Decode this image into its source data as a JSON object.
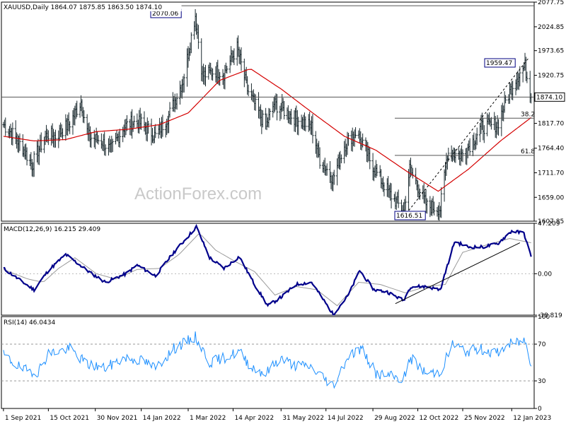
{
  "chart_data": [
    {
      "type": "candlestick",
      "panel": "price",
      "header": "XAUUSD,Daily  1864.07 1875.85 1863.50 1874.10",
      "watermark": "ActionForex.com",
      "ylim": [
        1607.85,
        2077.75
      ],
      "y_ticks": [
        "2077.75",
        "2024.85",
        "1973.65",
        "1920.75",
        "1869.60",
        "1817.70",
        "1764.40",
        "1711.70",
        "1659.00",
        "1607.85"
      ],
      "last_price_label": "1874.10",
      "colors": {
        "price": "#1b2a2f",
        "ma": "#d40000",
        "grid": "#9a9a9a",
        "annot": "#000080"
      },
      "annotations": {
        "high": {
          "label": "2070.06",
          "value": 2070.06,
          "date": "2022-03-08"
        },
        "swing_high": {
          "label": "1959.47",
          "value": 1959.47,
          "date": "2023-01-25"
        },
        "low": {
          "label": "1616.51",
          "value": 1616.51,
          "date": "2022-09-28"
        },
        "fib_38": {
          "label": "38.2",
          "value": 1828.7
        },
        "fib_61": {
          "label": "61.8",
          "value": 1749.1
        },
        "horizontal": [
          2070.06,
          1874.1,
          1828.7,
          1749.1
        ]
      },
      "price_anchors": [
        [
          "2021-09-01",
          1815
        ],
        [
          "2021-09-10",
          1795
        ],
        [
          "2021-09-20",
          1765
        ],
        [
          "2021-09-29",
          1728
        ],
        [
          "2021-10-05",
          1760
        ],
        [
          "2021-10-14",
          1795
        ],
        [
          "2021-10-22",
          1790
        ],
        [
          "2021-11-05",
          1818
        ],
        [
          "2021-11-16",
          1865
        ],
        [
          "2021-11-23",
          1790
        ],
        [
          "2021-12-06",
          1780
        ],
        [
          "2021-12-15",
          1760
        ],
        [
          "2021-12-28",
          1810
        ],
        [
          "2022-01-05",
          1820
        ],
        [
          "2022-01-14",
          1818
        ],
        [
          "2022-01-28",
          1790
        ],
        [
          "2022-02-10",
          1835
        ],
        [
          "2022-02-24",
          1910
        ],
        [
          "2022-03-08",
          2050
        ],
        [
          "2022-03-15",
          1920
        ],
        [
          "2022-03-28",
          1930
        ],
        [
          "2022-04-05",
          1925
        ],
        [
          "2022-04-18",
          1980
        ],
        [
          "2022-04-28",
          1890
        ],
        [
          "2022-05-16",
          1810
        ],
        [
          "2022-05-24",
          1860
        ],
        [
          "2022-06-13",
          1830
        ],
        [
          "2022-06-30",
          1810
        ],
        [
          "2022-07-08",
          1740
        ],
        [
          "2022-07-21",
          1700
        ],
        [
          "2022-08-01",
          1770
        ],
        [
          "2022-08-12",
          1800
        ],
        [
          "2022-08-26",
          1740
        ],
        [
          "2022-09-02",
          1710
        ],
        [
          "2022-09-15",
          1665
        ],
        [
          "2022-09-28",
          1630
        ],
        [
          "2022-10-04",
          1720
        ],
        [
          "2022-10-21",
          1640
        ],
        [
          "2022-11-03",
          1635
        ],
        [
          "2022-11-10",
          1755
        ],
        [
          "2022-11-24",
          1750
        ],
        [
          "2022-12-05",
          1780
        ],
        [
          "2022-12-13",
          1810
        ],
        [
          "2022-12-29",
          1815
        ],
        [
          "2023-01-06",
          1865
        ],
        [
          "2023-01-16",
          1915
        ],
        [
          "2023-01-25",
          1940
        ],
        [
          "2023-01-31",
          1874
        ]
      ],
      "ma_anchors": [
        [
          "2021-09-01",
          1790
        ],
        [
          "2021-10-01",
          1780
        ],
        [
          "2021-11-01",
          1783
        ],
        [
          "2021-12-01",
          1800
        ],
        [
          "2022-01-01",
          1805
        ],
        [
          "2022-02-01",
          1815
        ],
        [
          "2022-03-01",
          1840
        ],
        [
          "2022-04-01",
          1910
        ],
        [
          "2022-05-01",
          1935
        ],
        [
          "2022-06-01",
          1890
        ],
        [
          "2022-07-01",
          1840
        ],
        [
          "2022-08-01",
          1790
        ],
        [
          "2022-09-01",
          1760
        ],
        [
          "2022-10-01",
          1715
        ],
        [
          "2022-11-01",
          1672
        ],
        [
          "2022-12-01",
          1720
        ],
        [
          "2023-01-01",
          1780
        ],
        [
          "2023-01-31",
          1830
        ]
      ]
    },
    {
      "type": "line",
      "panel": "macd",
      "header": "MACD(12,26,9) 16.215 29.409",
      "ylim": [
        -38.819,
        47.209
      ],
      "y_ticks": [
        "47.209",
        "0.00",
        "-38.819"
      ],
      "colors": {
        "macd": "#00008b",
        "signal": "#9a9a9a"
      },
      "trendline": {
        "from": [
          "2022-09-20",
          -28
        ],
        "to": [
          "2023-01-20",
          29
        ]
      },
      "macd_anchors": [
        [
          "2021-09-01",
          5
        ],
        [
          "2021-09-20",
          -8
        ],
        [
          "2021-10-01",
          -15
        ],
        [
          "2021-10-15",
          3
        ],
        [
          "2021-11-01",
          18
        ],
        [
          "2021-11-25",
          1
        ],
        [
          "2021-12-10",
          -8
        ],
        [
          "2021-12-30",
          0
        ],
        [
          "2022-01-10",
          8
        ],
        [
          "2022-01-28",
          -2
        ],
        [
          "2022-02-15",
          20
        ],
        [
          "2022-03-01",
          35
        ],
        [
          "2022-03-09",
          44
        ],
        [
          "2022-03-22",
          15
        ],
        [
          "2022-04-05",
          5
        ],
        [
          "2022-04-20",
          16
        ],
        [
          "2022-05-05",
          -10
        ],
        [
          "2022-05-18",
          -30
        ],
        [
          "2022-05-31",
          -22
        ],
        [
          "2022-06-15",
          -10
        ],
        [
          "2022-06-30",
          -8
        ],
        [
          "2022-07-21",
          -38
        ],
        [
          "2022-08-05",
          -20
        ],
        [
          "2022-08-16",
          3
        ],
        [
          "2022-08-30",
          -15
        ],
        [
          "2022-09-12",
          -17
        ],
        [
          "2022-09-28",
          -25
        ],
        [
          "2022-10-05",
          -12
        ],
        [
          "2022-10-20",
          -12
        ],
        [
          "2022-11-03",
          -15
        ],
        [
          "2022-11-17",
          30
        ],
        [
          "2022-12-01",
          25
        ],
        [
          "2022-12-15",
          25
        ],
        [
          "2022-12-29",
          28
        ],
        [
          "2023-01-12",
          40
        ],
        [
          "2023-01-24",
          38
        ],
        [
          "2023-01-31",
          16
        ]
      ],
      "signal_anchors": [
        [
          "2021-09-01",
          4
        ],
        [
          "2021-09-25",
          -5
        ],
        [
          "2021-10-10",
          -8
        ],
        [
          "2021-10-25",
          5
        ],
        [
          "2021-11-10",
          15
        ],
        [
          "2021-12-01",
          0
        ],
        [
          "2021-12-20",
          -5
        ],
        [
          "2022-01-10",
          4
        ],
        [
          "2022-02-01",
          5
        ],
        [
          "2022-02-20",
          18
        ],
        [
          "2022-03-12",
          38
        ],
        [
          "2022-03-28",
          22
        ],
        [
          "2022-04-15",
          12
        ],
        [
          "2022-05-05",
          2
        ],
        [
          "2022-05-25",
          -20
        ],
        [
          "2022-06-15",
          -12
        ],
        [
          "2022-07-05",
          -15
        ],
        [
          "2022-07-25",
          -30
        ],
        [
          "2022-08-15",
          -8
        ],
        [
          "2022-09-05",
          -10
        ],
        [
          "2022-09-30",
          -18
        ],
        [
          "2022-10-20",
          -12
        ],
        [
          "2022-11-08",
          -10
        ],
        [
          "2022-11-25",
          20
        ],
        [
          "2022-12-15",
          26
        ],
        [
          "2023-01-10",
          33
        ],
        [
          "2023-01-31",
          29
        ]
      ]
    },
    {
      "type": "line",
      "panel": "rsi",
      "header": "RSI(14) 46.0434",
      "ylim": [
        0,
        100
      ],
      "y_ticks": [
        "100",
        "70",
        "30",
        "0"
      ],
      "levels": [
        70,
        30
      ],
      "colors": {
        "rsi": "#1e90ff",
        "level": "#9a9a9a"
      },
      "rsi_anchors": [
        [
          "2021-09-01",
          58
        ],
        [
          "2021-09-20",
          42
        ],
        [
          "2021-10-05",
          40
        ],
        [
          "2021-10-15",
          60
        ],
        [
          "2021-11-05",
          65
        ],
        [
          "2021-11-22",
          48
        ],
        [
          "2021-12-10",
          44
        ],
        [
          "2021-12-28",
          55
        ],
        [
          "2022-01-15",
          52
        ],
        [
          "2022-01-28",
          44
        ],
        [
          "2022-02-15",
          65
        ],
        [
          "2022-03-08",
          78
        ],
        [
          "2022-03-22",
          50
        ],
        [
          "2022-04-05",
          55
        ],
        [
          "2022-04-20",
          62
        ],
        [
          "2022-05-02",
          45
        ],
        [
          "2022-05-16",
          38
        ],
        [
          "2022-05-30",
          55
        ],
        [
          "2022-06-13",
          47
        ],
        [
          "2022-06-28",
          46
        ],
        [
          "2022-07-21",
          25
        ],
        [
          "2022-08-05",
          58
        ],
        [
          "2022-08-18",
          65
        ],
        [
          "2022-09-01",
          38
        ],
        [
          "2022-09-15",
          35
        ],
        [
          "2022-09-28",
          32
        ],
        [
          "2022-10-05",
          55
        ],
        [
          "2022-10-20",
          38
        ],
        [
          "2022-11-03",
          40
        ],
        [
          "2022-11-15",
          70
        ],
        [
          "2022-11-28",
          62
        ],
        [
          "2022-12-12",
          65
        ],
        [
          "2022-12-28",
          60
        ],
        [
          "2023-01-10",
          70
        ],
        [
          "2023-01-25",
          74
        ],
        [
          "2023-01-31",
          46
        ]
      ]
    }
  ],
  "x_axis": {
    "ticks": [
      {
        "label": "1 Sep 2021",
        "date": "2021-09-01"
      },
      {
        "label": "15 Oct 2021",
        "date": "2021-10-15"
      },
      {
        "label": "30 Nov 2021",
        "date": "2021-11-30"
      },
      {
        "label": "14 Jan 2022",
        "date": "2022-01-14"
      },
      {
        "label": "1 Mar 2022",
        "date": "2022-03-01"
      },
      {
        "label": "14 Apr 2022",
        "date": "2022-04-14"
      },
      {
        "label": "31 May 2022",
        "date": "2022-05-31"
      },
      {
        "label": "14 Jul 2022",
        "date": "2022-07-14"
      },
      {
        "label": "29 Aug 2022",
        "date": "2022-08-29"
      },
      {
        "label": "12 Oct 2022",
        "date": "2022-10-12"
      },
      {
        "label": "25 Nov 2022",
        "date": "2022-11-25"
      },
      {
        "label": "12 Jan 2023",
        "date": "2023-01-12"
      }
    ]
  }
}
